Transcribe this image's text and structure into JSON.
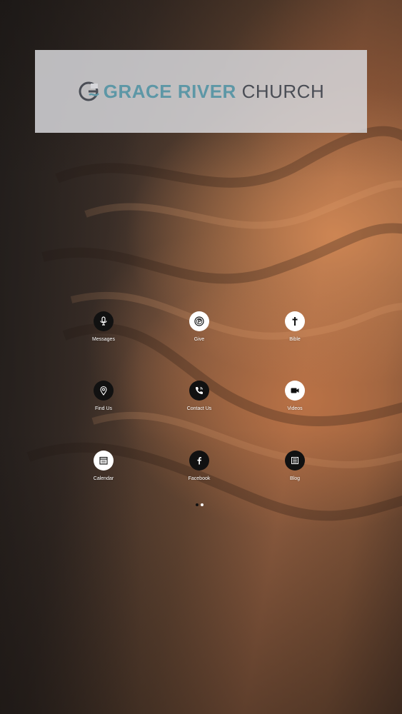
{
  "logo": {
    "mark_letters": "G",
    "name_strong": "GRACE RIVER",
    "name_light": "CHURCH"
  },
  "colors": {
    "logo_accent": "#5d97a6",
    "logo_text": "#4a4d55",
    "icon_dark": "#111111",
    "icon_light": "#ffffff"
  },
  "tiles": [
    {
      "label": "Messages",
      "icon": "microphone-icon",
      "style": "dark"
    },
    {
      "label": "Give",
      "icon": "give-icon",
      "style": "light"
    },
    {
      "label": "Bible",
      "icon": "cross-icon",
      "style": "light"
    },
    {
      "label": "Find Us",
      "icon": "map-pin-icon",
      "style": "dark"
    },
    {
      "label": "Contact Us",
      "icon": "phone-icon",
      "style": "dark"
    },
    {
      "label": "Videos",
      "icon": "video-camera-icon",
      "style": "light"
    },
    {
      "label": "Calendar",
      "icon": "calendar-icon",
      "style": "light"
    },
    {
      "label": "Facebook",
      "icon": "facebook-icon",
      "style": "dark"
    },
    {
      "label": "Blog",
      "icon": "news-icon",
      "style": "dark"
    }
  ],
  "pager": {
    "pages": 2,
    "current": 2
  }
}
